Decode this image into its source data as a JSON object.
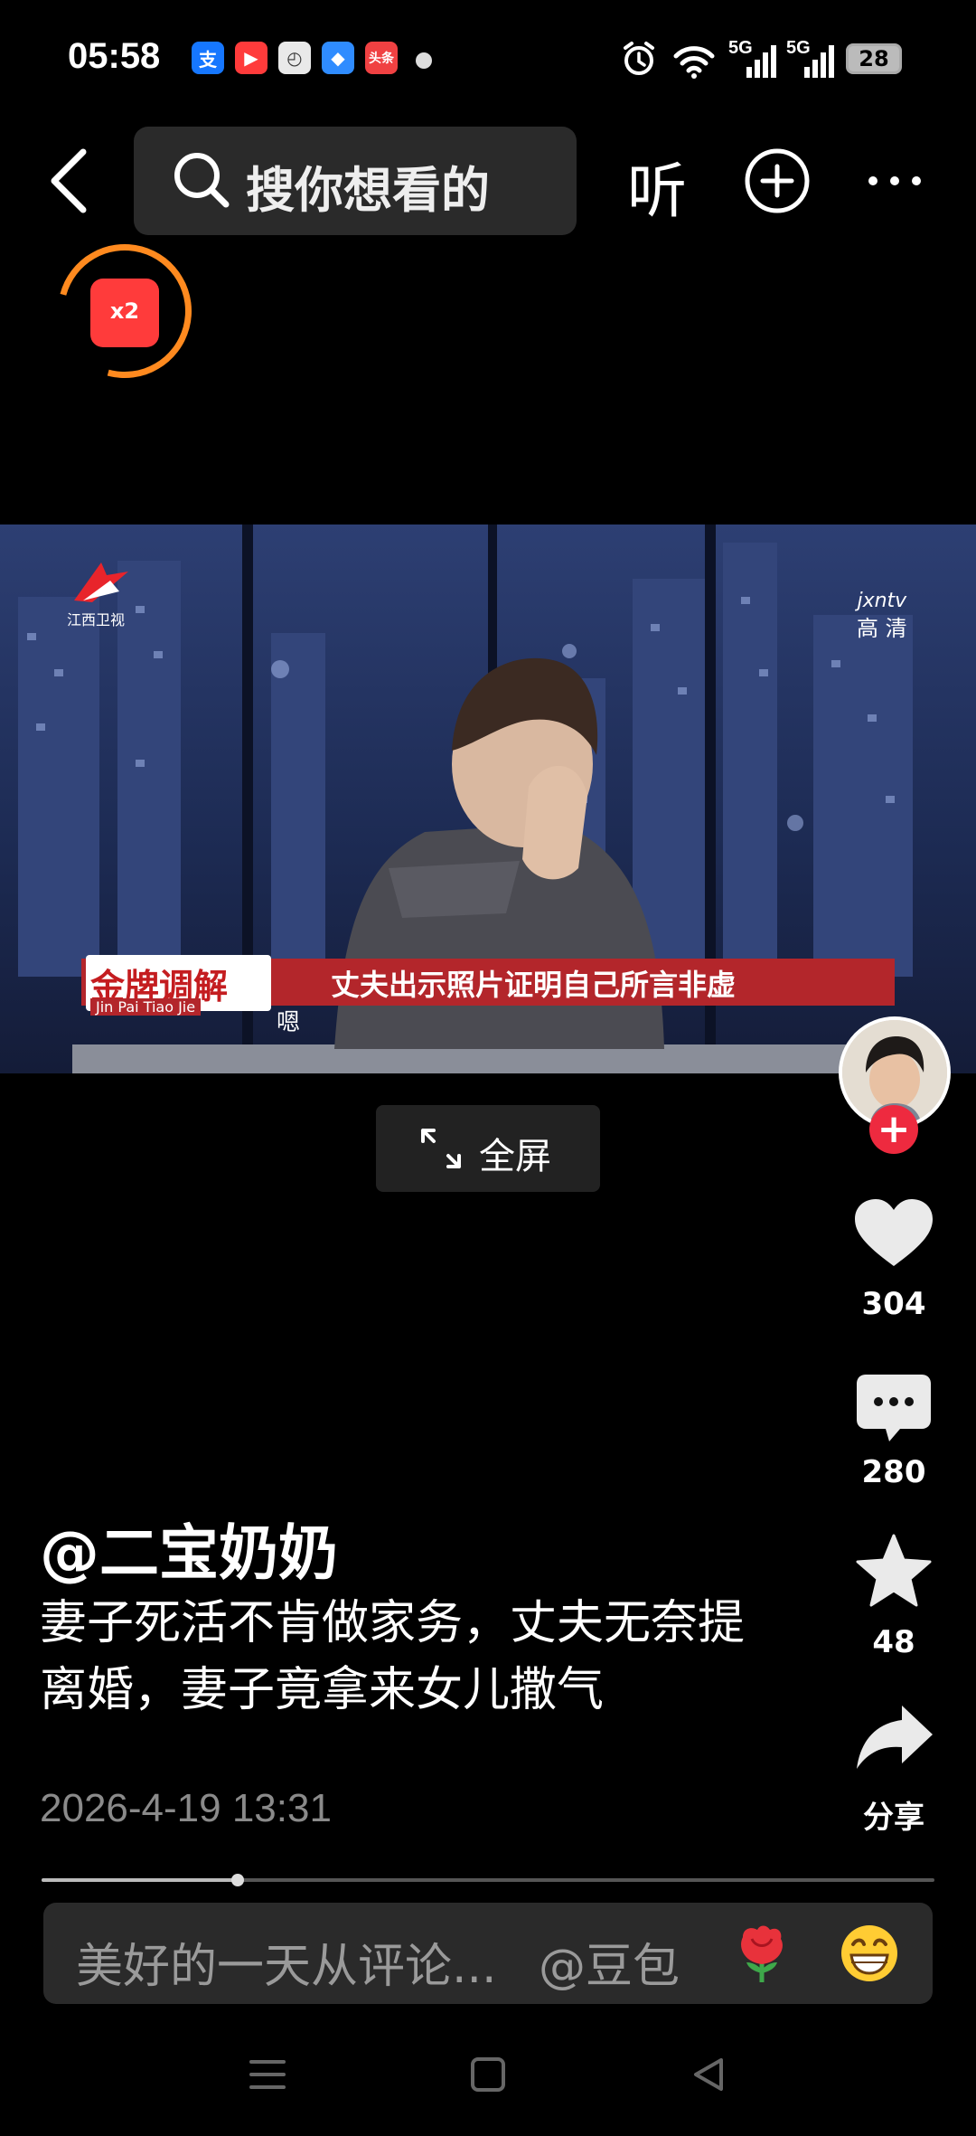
{
  "status_bar": {
    "time": "05:58",
    "app_icons": [
      {
        "name": "alipay",
        "glyph": "支",
        "color": "#1677ff"
      },
      {
        "name": "video-app",
        "glyph": "▶",
        "color": "#ff3b3b"
      },
      {
        "name": "clock-app",
        "glyph": "◴",
        "color": "#e9e9e9"
      },
      {
        "name": "browser-app",
        "glyph": "◆",
        "color": "#2f8cff"
      },
      {
        "name": "toutiao",
        "glyph": "头条",
        "color": "#f04142"
      }
    ],
    "signal_1": "5G",
    "signal_2": "5G",
    "battery": "28"
  },
  "nav": {
    "search_placeholder": "搜你想看的",
    "listen_label": "听"
  },
  "red_packet": {
    "label": "x2"
  },
  "video": {
    "channel": "江西卫视",
    "hd_site": "jxntv",
    "hd_label": "高 清",
    "show_logo": "金牌调解",
    "show_logo_pinyin": "Jin Pai  Tiao Jie",
    "caption": "丈夫出示照片证明自己所言非虚",
    "subtitle": "嗯"
  },
  "fullscreen": {
    "label": "全屏"
  },
  "actions": {
    "like_count": "304",
    "comment_count": "280",
    "favorite_count": "48",
    "share_label": "分享"
  },
  "post": {
    "author": "@二宝奶奶",
    "description": "妻子死活不肯做家务，丈夫无奈提离婚，妻子竟拿来女儿撒气",
    "timestamp": "2026-4-19 13:31"
  },
  "progress": {
    "fraction": 0.22
  },
  "comment_bar": {
    "placeholder": "美好的一天从评论...",
    "mention": "@豆包"
  }
}
